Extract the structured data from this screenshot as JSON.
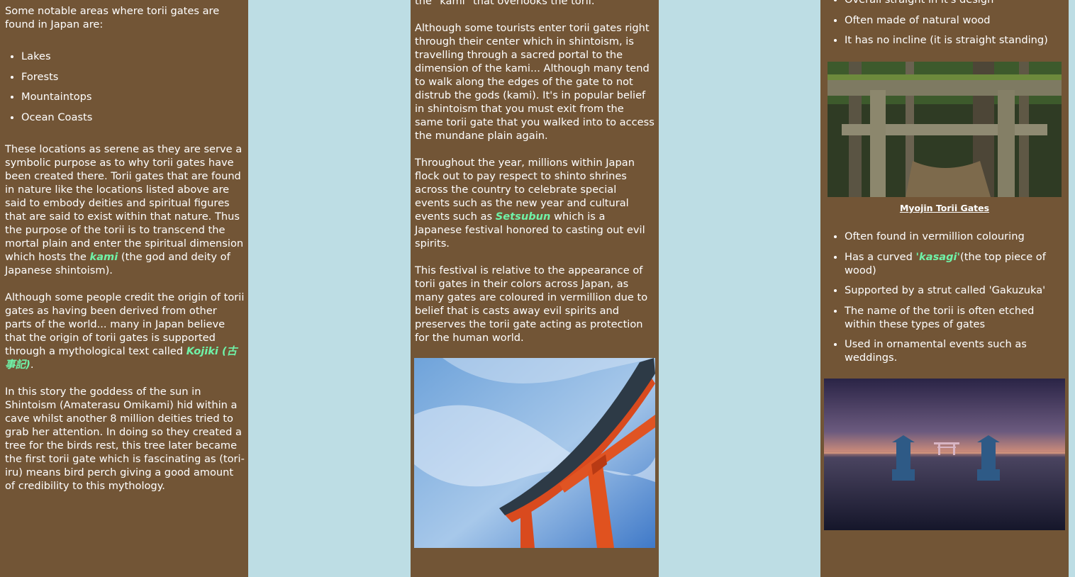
{
  "left": {
    "intro": "Some notable areas where torii gates are found in Japan are:",
    "areas": [
      "Lakes",
      "Forests",
      "Mountaintops",
      "Ocean Coasts"
    ],
    "p1_a": "These locations as serene as they are serve a symbolic purpose as to why torii gates have been created there. Torii gates that are found in nature like the locations listed above are said to embody deities and spiritual figures that are said to exist within that nature. Thus the purpose of the torii is to transcend the mortal plain and enter the spiritual dimension which hosts the ",
    "p1_hl": "kami",
    "p1_b": " (the god and deity of Japanese shintoism).",
    "p2_a": "Although some people credit the origin of torii gates as having been derived from other parts of the world... many in Japan believe that the origin of torii gates is supported through a mythological text called ",
    "p2_hl": "Kojiki (古事記)",
    "p2_b": ".",
    "p3": "In this story the goddess of the sun in Shintoism (Amaterasu Omikami) hid within a cave whilst another 8 million deities tried to grab her attention. In doing so they created a tree for the birds rest, this tree later became the first torii gate which is fascinating as (tori-iru) means bird perch giving a good amount of credibility to this mythology."
  },
  "middle": {
    "clipped_top": "the \"kami\" that overlooks the torii.",
    "p1": "Although some tourists enter torii gates right through their center which in shintoism, is travelling through a sacred portal to the dimension of the kami... Although many tend to walk along the edges of the gate to not distrub the gods (kami). It's in popular belief in shintoism that you must exit from the same torii gate that you walked into to access the mundane plain again.",
    "p2_a": "Throughout the year, millions within Japan flock out to pay respect to shinto shrines across the country to celebrate special events such as the new year and cultural events such as ",
    "p2_hl": "Setsubun",
    "p2_b": " which is a Japanese festival honored to casting out evil spirits.",
    "p3": "This festival is relative to the appearance of torii gates in their colors across Japan, as many gates are coloured in vermillion due to belief that is casts away evil spirits and preserves the torii gate acting as protection for the human world."
  },
  "right": {
    "top_list": [
      "Overall straight in it's design",
      "Often made of natural wood",
      "It has no incline (it is straight standing)"
    ],
    "caption": "Myojin Torii Gates",
    "myojin_1": "Often found in vermillion colouring",
    "myojin_2_a": "Has a curved ",
    "myojin_2_hl": "'kasagi'",
    "myojin_2_b": "(the top piece of wood)",
    "myojin_3": "Supported by a strut called 'Gakuzuka'",
    "myojin_4": "The name of the torii is often etched within these types of gates",
    "myojin_5": "Used in ornamental events such as weddings."
  },
  "colors": {
    "background": "#bddde4",
    "panel": "#725536",
    "highlight": "#6ff3a8",
    "text": "#ffffff"
  }
}
